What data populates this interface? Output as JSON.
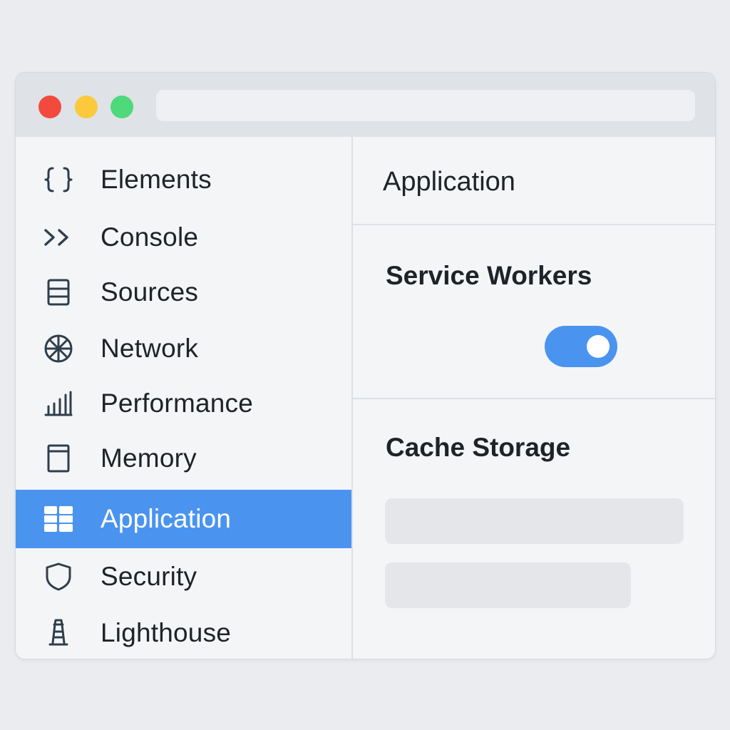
{
  "window": {
    "controls": {
      "close": "close-light",
      "minimize": "minimize-light",
      "maximize": "maximize-light"
    },
    "address_bar": {
      "value": ""
    }
  },
  "sidebar": {
    "items": [
      {
        "label": "Elements",
        "icon": "braces-icon",
        "active": false
      },
      {
        "label": "Console",
        "icon": "chevrons-right-icon",
        "active": false
      },
      {
        "label": "Sources",
        "icon": "layers-icon",
        "active": false
      },
      {
        "label": "Network",
        "icon": "globe-icon",
        "active": false
      },
      {
        "label": "Performance",
        "icon": "bar-chart-icon",
        "active": false
      },
      {
        "label": "Memory",
        "icon": "memory-icon",
        "active": false
      },
      {
        "label": "Application",
        "icon": "grid-icon",
        "active": true
      },
      {
        "label": "Security",
        "icon": "shield-icon",
        "active": false
      },
      {
        "label": "Lighthouse",
        "icon": "lighthouse-icon",
        "active": false
      }
    ]
  },
  "main": {
    "title": "Application",
    "service_workers": {
      "title": "Service Workers",
      "toggle_on": true
    },
    "cache_storage": {
      "title": "Cache Storage"
    }
  },
  "colors": {
    "accent": "#4a94f0",
    "close": "#f24a3d",
    "minimize": "#fbc93b",
    "maximize": "#4ed97b"
  }
}
